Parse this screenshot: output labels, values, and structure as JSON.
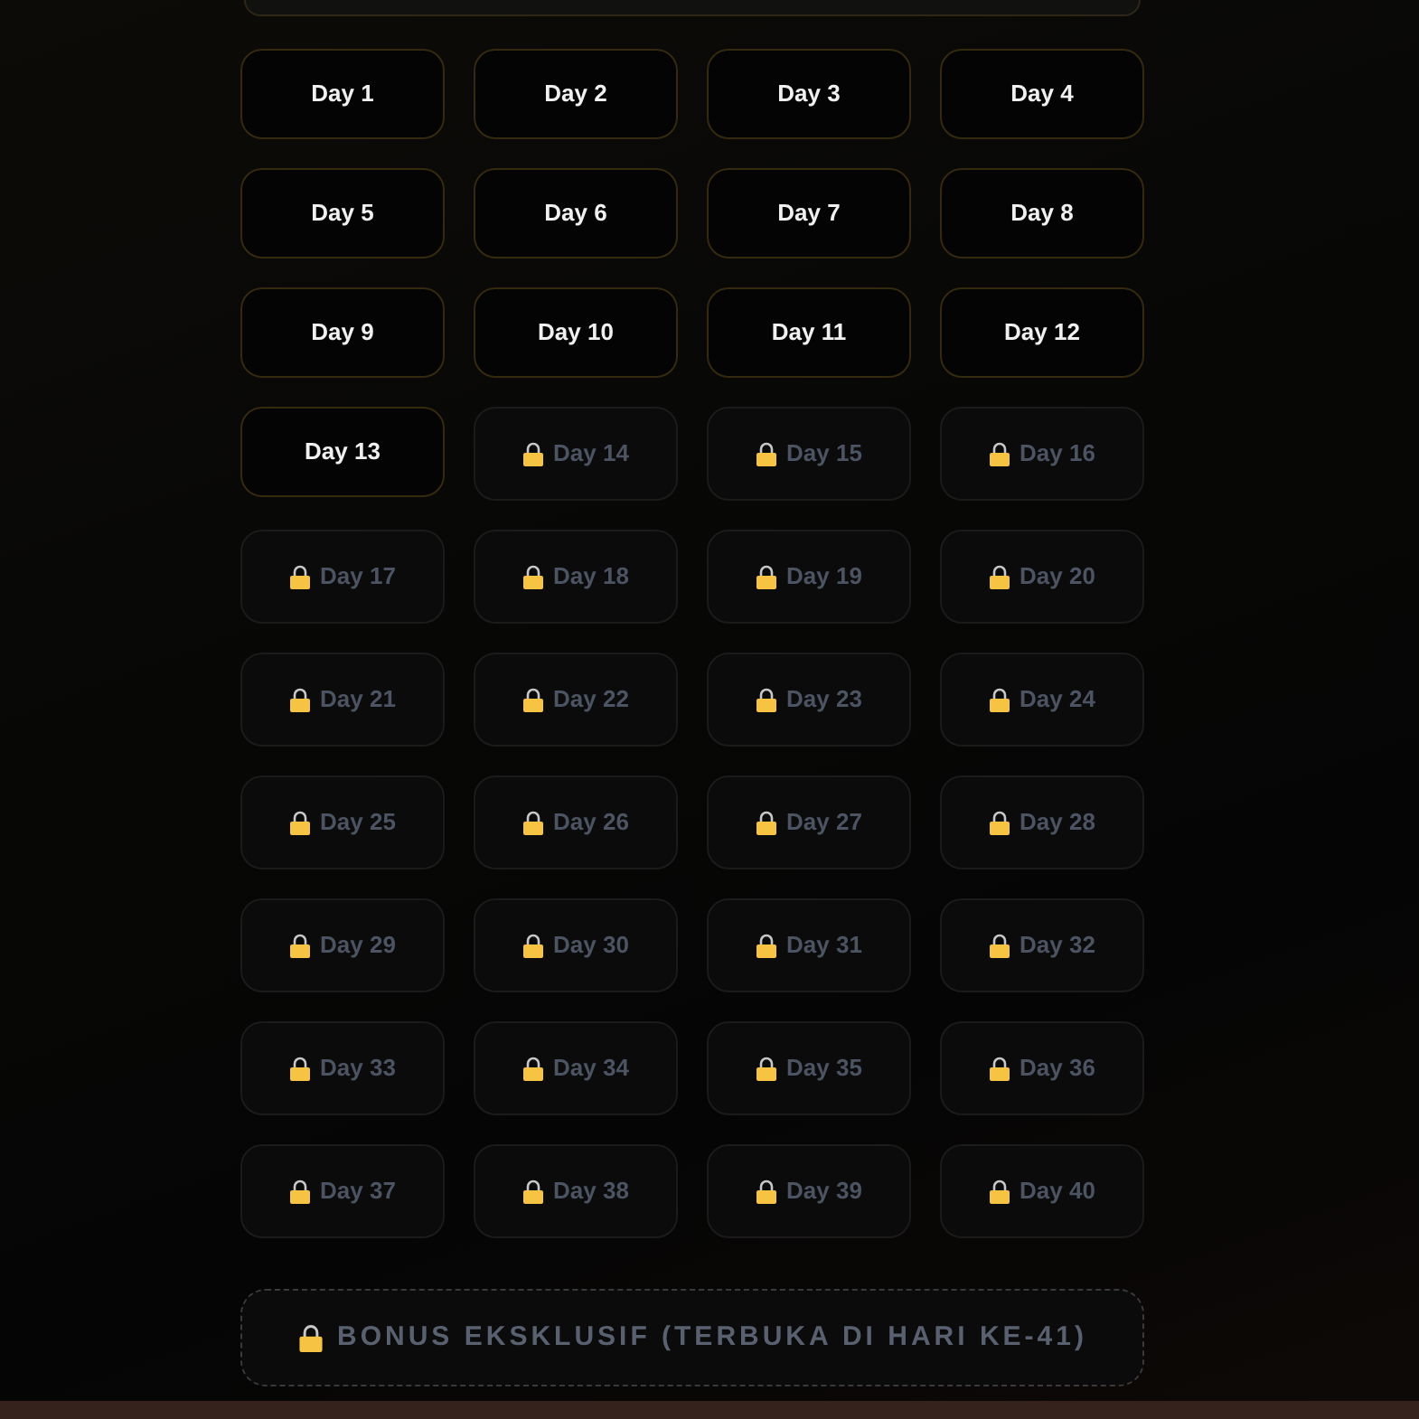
{
  "days": [
    {
      "label": "Day 1",
      "locked": false
    },
    {
      "label": "Day 2",
      "locked": false
    },
    {
      "label": "Day 3",
      "locked": false
    },
    {
      "label": "Day 4",
      "locked": false
    },
    {
      "label": "Day 5",
      "locked": false
    },
    {
      "label": "Day 6",
      "locked": false
    },
    {
      "label": "Day 7",
      "locked": false
    },
    {
      "label": "Day 8",
      "locked": false
    },
    {
      "label": "Day 9",
      "locked": false
    },
    {
      "label": "Day 10",
      "locked": false
    },
    {
      "label": "Day 11",
      "locked": false
    },
    {
      "label": "Day 12",
      "locked": false
    },
    {
      "label": "Day 13",
      "locked": false
    },
    {
      "label": "Day 14",
      "locked": true
    },
    {
      "label": "Day 15",
      "locked": true
    },
    {
      "label": "Day 16",
      "locked": true
    },
    {
      "label": "Day 17",
      "locked": true
    },
    {
      "label": "Day 18",
      "locked": true
    },
    {
      "label": "Day 19",
      "locked": true
    },
    {
      "label": "Day 20",
      "locked": true
    },
    {
      "label": "Day 21",
      "locked": true
    },
    {
      "label": "Day 22",
      "locked": true
    },
    {
      "label": "Day 23",
      "locked": true
    },
    {
      "label": "Day 24",
      "locked": true
    },
    {
      "label": "Day 25",
      "locked": true
    },
    {
      "label": "Day 26",
      "locked": true
    },
    {
      "label": "Day 27",
      "locked": true
    },
    {
      "label": "Day 28",
      "locked": true
    },
    {
      "label": "Day 29",
      "locked": true
    },
    {
      "label": "Day 30",
      "locked": true
    },
    {
      "label": "Day 31",
      "locked": true
    },
    {
      "label": "Day 32",
      "locked": true
    },
    {
      "label": "Day 33",
      "locked": true
    },
    {
      "label": "Day 34",
      "locked": true
    },
    {
      "label": "Day 35",
      "locked": true
    },
    {
      "label": "Day 36",
      "locked": true
    },
    {
      "label": "Day 37",
      "locked": true
    },
    {
      "label": "Day 38",
      "locked": true
    },
    {
      "label": "Day 39",
      "locked": true
    },
    {
      "label": "Day 40",
      "locked": true
    }
  ],
  "bonus": {
    "label": "BONUS EKSKLUSIF (TERBUKA DI HARI KE-41)",
    "locked": true
  }
}
